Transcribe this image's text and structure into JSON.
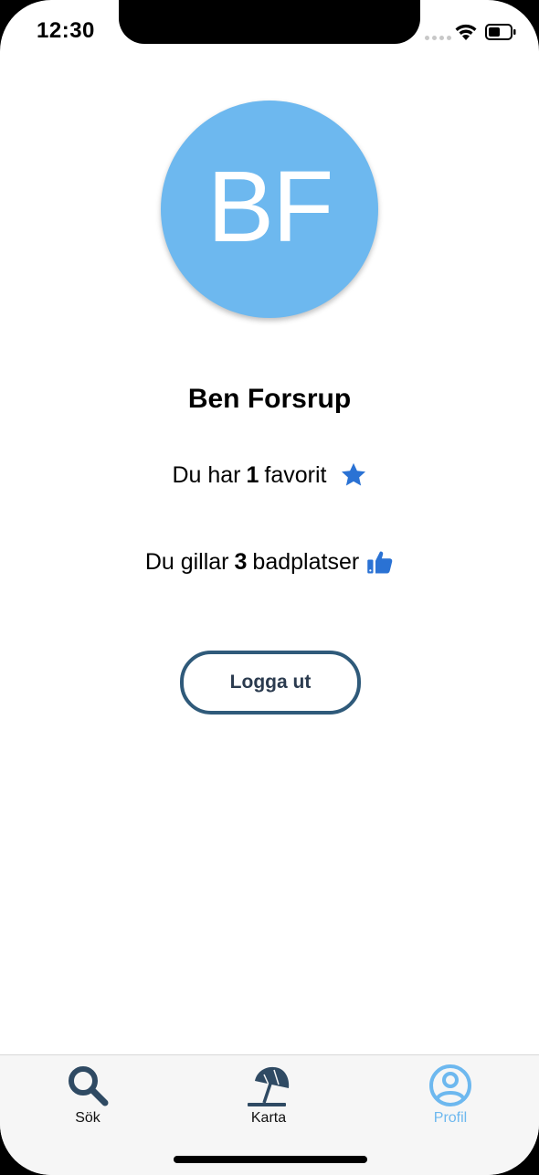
{
  "status_bar": {
    "time": "12:30"
  },
  "profile": {
    "initials": "BF",
    "name": "Ben Forsrup",
    "favorites": {
      "prefix": "Du har",
      "count": "1",
      "suffix": "favorit"
    },
    "likes": {
      "prefix": "Du gillar",
      "count": "3",
      "suffix": "badplatser"
    },
    "logout_label": "Logga ut"
  },
  "tabs": [
    {
      "label": "Sök",
      "icon": "search-icon",
      "active": false
    },
    {
      "label": "Karta",
      "icon": "beach-umbrella-icon",
      "active": false
    },
    {
      "label": "Profil",
      "icon": "user-circle-icon",
      "active": true
    }
  ],
  "colors": {
    "avatar": "#6db8ef",
    "accent": "#2a72d4",
    "button_border": "#2f5a7a",
    "tab_icon": "#2f4a63",
    "tab_active": "#6db8ef"
  }
}
